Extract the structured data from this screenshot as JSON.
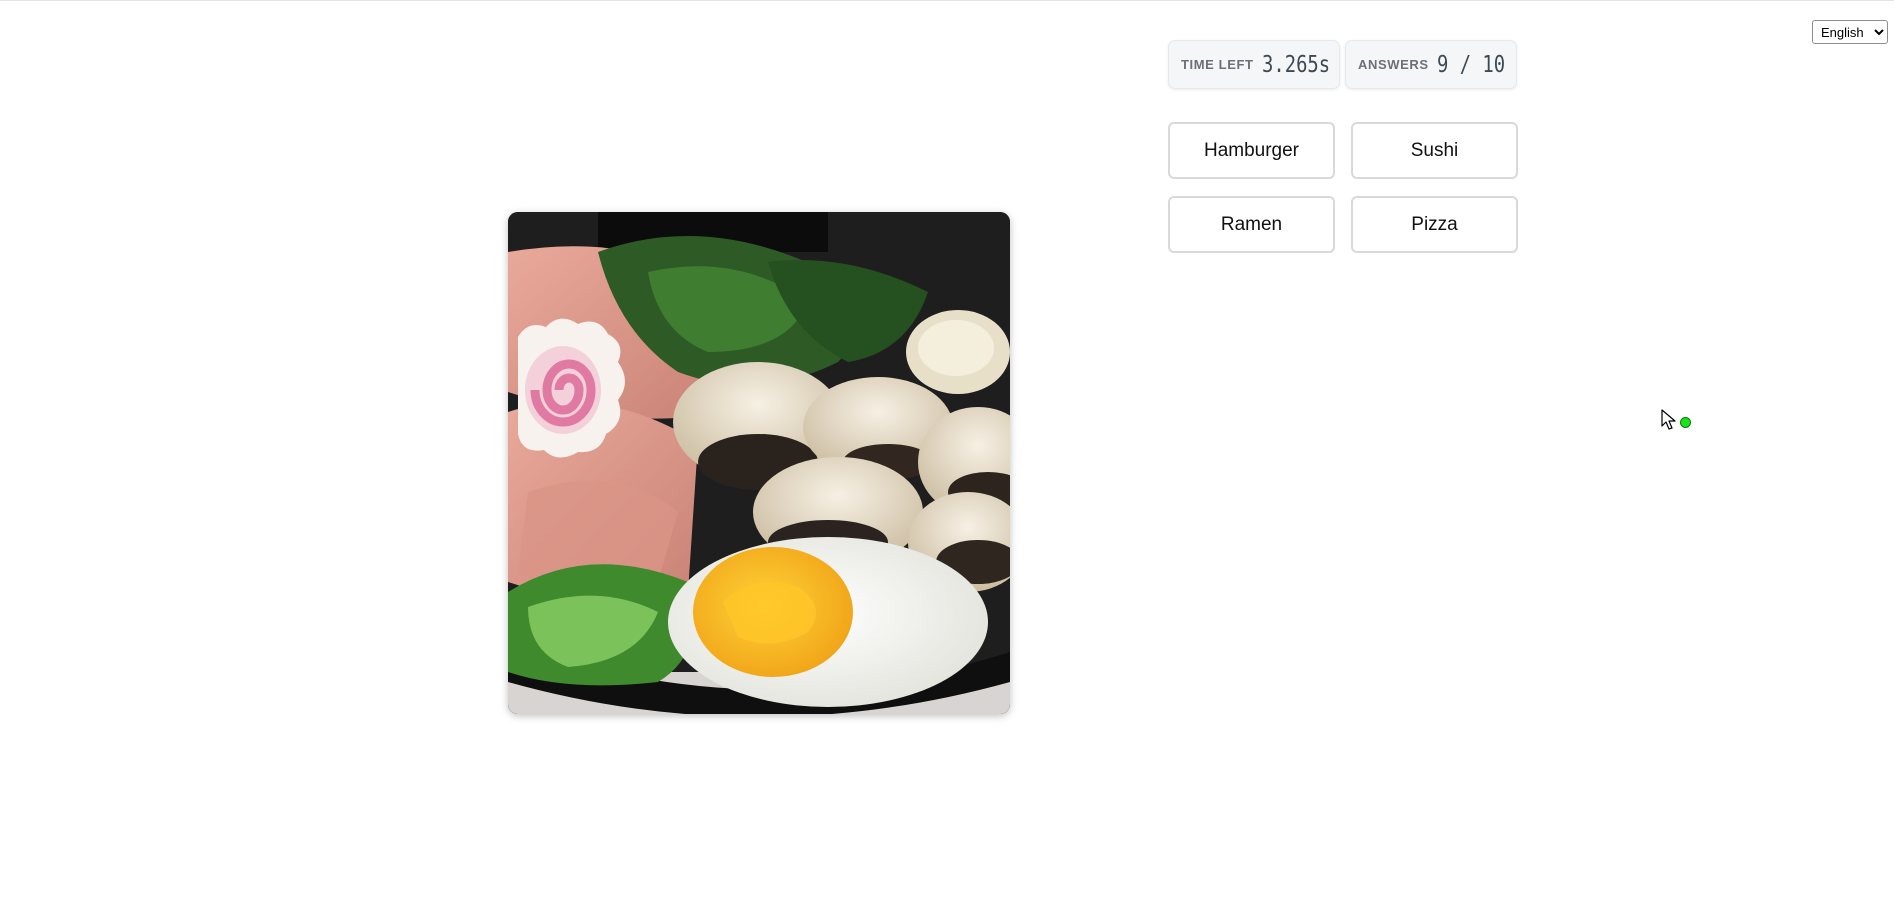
{
  "language": {
    "selected": "English",
    "options": [
      "English"
    ]
  },
  "stats": {
    "time_left_label": "TIME LEFT",
    "time_left_value": "3.265s",
    "answers_label": "ANSWERS",
    "answers_value": "9 / 10"
  },
  "answers": [
    {
      "label": "Hamburger"
    },
    {
      "label": "Sushi"
    },
    {
      "label": "Ramen"
    },
    {
      "label": "Pizza"
    }
  ],
  "image": {
    "subject": "ramen-bowl-photo"
  },
  "colors": {
    "indicator": "#19e319",
    "stat_text": "#3c4a55",
    "button_border": "#d9d9d9"
  }
}
